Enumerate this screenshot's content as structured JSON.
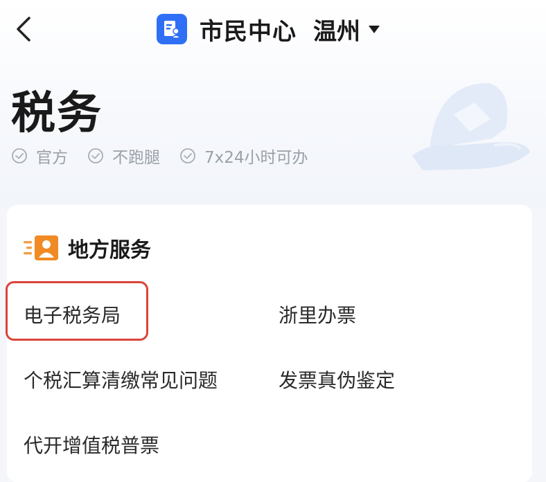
{
  "header": {
    "app_title": "市民中心",
    "city": "温州"
  },
  "page": {
    "title": "税务",
    "tags": [
      "官方",
      "不跑腿",
      "7x24小时可办"
    ]
  },
  "section": {
    "title": "地方服务",
    "services": [
      "电子税务局",
      "浙里办票",
      "个税汇算清缴常见问题",
      "发票真伪鉴定",
      "代开增值税普票"
    ]
  },
  "colors": {
    "brand_blue": "#2f6ff5",
    "section_icon_orange": "#f08a24",
    "highlight_red": "#d9443a"
  }
}
